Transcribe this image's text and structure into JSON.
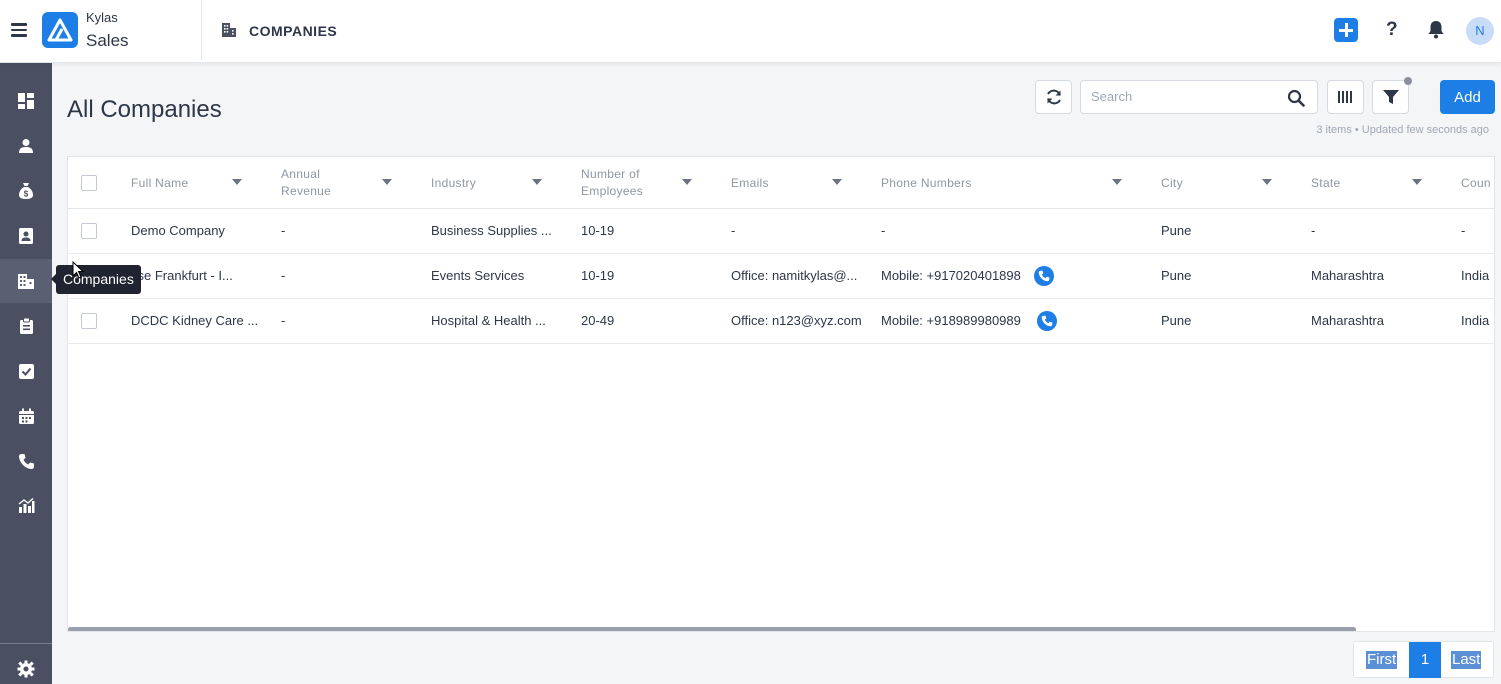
{
  "app": {
    "brand_top": "Kylas",
    "brand_bottom": "Sales",
    "module_title": "COMPANIES",
    "avatar_initial": "N"
  },
  "header_icons": [
    "hamburger-icon",
    "plus-icon",
    "help-icon",
    "bell-icon"
  ],
  "sidebar": {
    "items": [
      "dashboard-icon",
      "contacts-icon",
      "deals-icon",
      "leads-icon",
      "companies-icon",
      "products-icon",
      "tasks-icon",
      "calendar-icon",
      "calls-icon",
      "reports-icon",
      "settings-icon"
    ],
    "active": "companies-icon",
    "tooltip": "Companies"
  },
  "toolbar": {
    "page_title": "All Companies",
    "search_placeholder": "Search",
    "add_label": "Add",
    "meta": "3 items • Updated few seconds ago"
  },
  "table": {
    "columns": [
      {
        "label": "Full Name"
      },
      {
        "label": "Annual Revenue"
      },
      {
        "label": "Industry"
      },
      {
        "label": "Number of Employees"
      },
      {
        "label": "Emails"
      },
      {
        "label": "Phone Numbers"
      },
      {
        "label": "City"
      },
      {
        "label": "State"
      },
      {
        "label": "Coun"
      }
    ],
    "rows": [
      {
        "name": "Demo Company",
        "revenue": "-",
        "industry": "Business Supplies ...",
        "employees": "10-19",
        "email": "-",
        "phone": "-",
        "city": "Pune",
        "state": "-",
        "country": "-",
        "has_call": false
      },
      {
        "name": "sse Frankfurt - I...",
        "revenue": "-",
        "industry": "Events Services",
        "employees": "10-19",
        "email": "Office: namitkylas@...",
        "phone": "Mobile: +917020401898",
        "city": "Pune",
        "state": "Maharashtra",
        "country": "India",
        "has_call": true
      },
      {
        "name": "DCDC Kidney Care ...",
        "revenue": "-",
        "industry": "Hospital & Health ...",
        "employees": "20-49",
        "email": "Office: n123@xyz.com",
        "phone": "Mobile: +918989980989",
        "city": "Pune",
        "state": "Maharashtra",
        "country": "India",
        "has_call": true
      }
    ]
  },
  "pagination": {
    "first": "First",
    "current": "1",
    "last": "Last"
  },
  "colors": {
    "accent": "#1d7ee6",
    "sidebar": "#4a5061"
  }
}
